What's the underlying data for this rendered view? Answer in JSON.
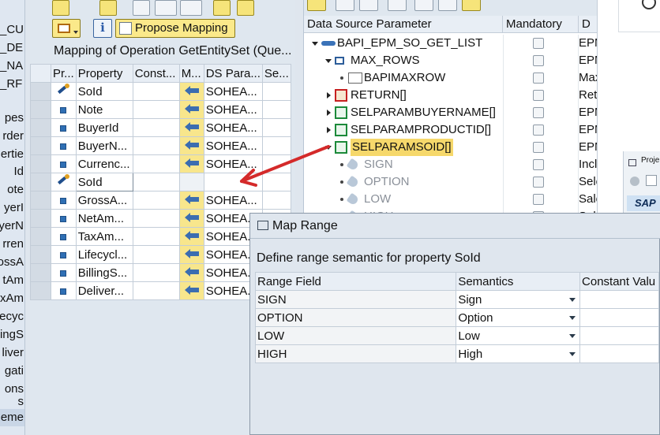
{
  "left_strip": {
    "items": [
      "_CU",
      "_DE",
      "_NA",
      "_RF",
      "pes",
      "rder",
      "ertie",
      "Id",
      "ote",
      "yerI",
      "yerN",
      "rren",
      "ossA",
      "tAm",
      "xAm",
      "ecyc",
      "lingS",
      "liver",
      "gati",
      "ons",
      "s",
      "leme"
    ]
  },
  "toolbar": {
    "propose_label": "Propose Mapping",
    "info_label": "i"
  },
  "mapping": {
    "title": "Mapping of Operation GetEntitySet (Que...",
    "columns": [
      "Pr...",
      "Property",
      "Const...",
      "M...",
      "DS Para...",
      "Se..."
    ],
    "rows": [
      {
        "icon": "key-icon",
        "property": "SoId",
        "const": "",
        "mapped": true,
        "ds": "SOHEA..."
      },
      {
        "icon": "property-icon",
        "property": "Note",
        "const": "",
        "mapped": true,
        "ds": "SOHEA..."
      },
      {
        "icon": "property-icon",
        "property": "BuyerId",
        "const": "",
        "mapped": true,
        "ds": "SOHEA..."
      },
      {
        "icon": "property-icon",
        "property": "BuyerN...",
        "const": "",
        "mapped": true,
        "ds": "SOHEA..."
      },
      {
        "icon": "property-icon",
        "property": "Currenc...",
        "const": "",
        "mapped": true,
        "ds": "SOHEA..."
      },
      {
        "icon": "key-icon",
        "property": "SoId",
        "const": "",
        "mapped": false,
        "ds": ""
      },
      {
        "icon": "property-icon",
        "property": "GrossA...",
        "const": "",
        "mapped": true,
        "ds": "SOHEA..."
      },
      {
        "icon": "property-icon",
        "property": "NetAm...",
        "const": "",
        "mapped": true,
        "ds": "SOHEA..."
      },
      {
        "icon": "property-icon",
        "property": "TaxAm...",
        "const": "",
        "mapped": true,
        "ds": "SOHEA..."
      },
      {
        "icon": "property-icon",
        "property": "Lifecycl...",
        "const": "",
        "mapped": true,
        "ds": "SOHEA..."
      },
      {
        "icon": "property-icon",
        "property": "BillingS...",
        "const": "",
        "mapped": true,
        "ds": "SOHEA..."
      },
      {
        "icon": "property-icon",
        "property": "Deliver...",
        "const": "",
        "mapped": true,
        "ds": "SOHEA..."
      }
    ]
  },
  "tree": {
    "columns": [
      "Data Source Parameter",
      "Mandatory",
      "D"
    ],
    "nodes": [
      {
        "label": "BAPI_EPM_SO_GET_LIST",
        "d": "EPM",
        "expander": "down",
        "icon": "function-icon",
        "indent": 0,
        "greyed": false,
        "highlight": false
      },
      {
        "label": "MAX_ROWS",
        "d": "EPM",
        "expander": "down",
        "icon": "structure-icon",
        "indent": 1,
        "greyed": false,
        "highlight": false
      },
      {
        "label": "BAPIMAXROW",
        "d": "Max",
        "expander": "bullet",
        "icon": "field-icon",
        "indent": 2,
        "greyed": false,
        "highlight": false
      },
      {
        "label": "RETURN[]",
        "d": "Ret",
        "expander": "right",
        "icon": "error-table-icon",
        "indent": 1,
        "greyed": false,
        "highlight": false
      },
      {
        "label": "SELPARAMBUYERNAME[]",
        "d": "EPM",
        "expander": "right",
        "icon": "table-icon",
        "indent": 1,
        "greyed": false,
        "highlight": false
      },
      {
        "label": "SELPARAMPRODUCTID[]",
        "d": "EPM",
        "expander": "right",
        "icon": "table-icon",
        "indent": 1,
        "greyed": false,
        "highlight": false
      },
      {
        "label": "SELPARAMSOID[]",
        "d": "EPM",
        "expander": "down",
        "icon": "table-icon",
        "indent": 1,
        "greyed": false,
        "highlight": true
      },
      {
        "label": "SIGN",
        "d": "Incl",
        "expander": "bullet",
        "icon": "tag-icon",
        "indent": 2,
        "greyed": true,
        "highlight": false
      },
      {
        "label": "OPTION",
        "d": "Sele",
        "expander": "bullet",
        "icon": "tag-icon",
        "indent": 2,
        "greyed": true,
        "highlight": false
      },
      {
        "label": "LOW",
        "d": "Sale",
        "expander": "bullet",
        "icon": "tag-icon",
        "indent": 2,
        "greyed": true,
        "highlight": false
      },
      {
        "label": "HIGH",
        "d": "Sale",
        "expander": "bullet",
        "icon": "tag-icon",
        "indent": 2,
        "greyed": true,
        "highlight": false
      }
    ]
  },
  "far_right": {
    "proj_label": "Proje",
    "sap_label": "SAP"
  },
  "dialog": {
    "title": "Map Range",
    "caption": "Define range semantic for property SoId",
    "columns": [
      "Range Field",
      "Semantics",
      "Constant Valu"
    ],
    "rows": [
      {
        "field": "SIGN",
        "semantics": "Sign",
        "constant": ""
      },
      {
        "field": "OPTION",
        "semantics": "Option",
        "constant": ""
      },
      {
        "field": "LOW",
        "semantics": "Low",
        "constant": ""
      },
      {
        "field": "HIGH",
        "semantics": "High",
        "constant": ""
      }
    ]
  },
  "colors": {
    "annotation_arrow": "#d42a2a",
    "highlight": "#f6d86b",
    "button_yellow": "#fbe98a"
  }
}
